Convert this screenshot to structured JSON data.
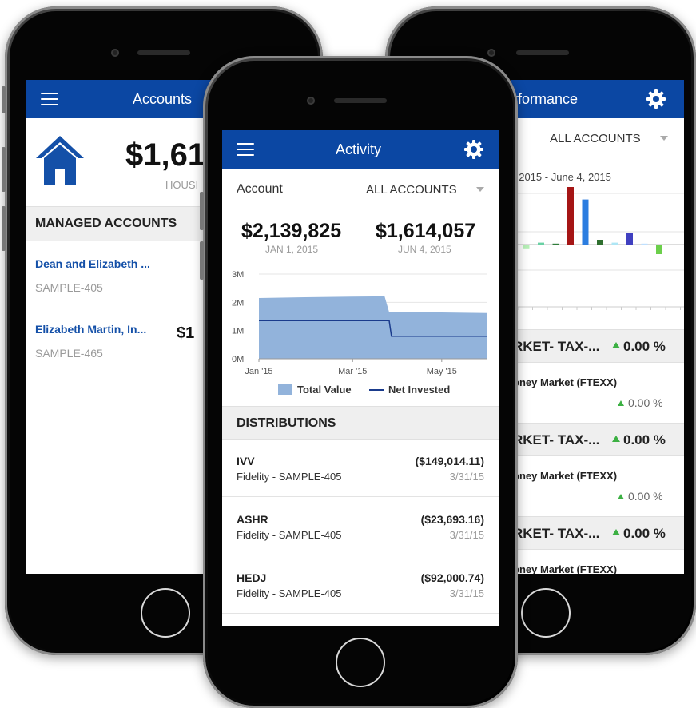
{
  "left": {
    "title": "Accounts",
    "total": "$1,61",
    "subtitle": "HOUSI",
    "section": "MANAGED ACCOUNTS",
    "items": [
      {
        "name": "Dean and Elizabeth ...",
        "id": "SAMPLE-405",
        "value": ""
      },
      {
        "name": "Elizabeth Martin, In...",
        "id": "SAMPLE-465",
        "value": "$1"
      }
    ]
  },
  "center": {
    "title": "Activity",
    "account_label": "Account",
    "account_value": "ALL ACCOUNTS",
    "start_value": "$2,139,825",
    "start_date": "JAN 1, 2015",
    "end_value": "$1,614,057",
    "end_date": "JUN 4, 2015",
    "legend": {
      "total": "Total Value",
      "net": "Net Invested"
    },
    "section": "DISTRIBUTIONS",
    "distributions": [
      {
        "symbol": "IVV",
        "account": "Fidelity - SAMPLE-405",
        "amount": "($149,014.11)",
        "date": "3/31/15"
      },
      {
        "symbol": "ASHR",
        "account": "Fidelity - SAMPLE-405",
        "amount": "($23,693.16)",
        "date": "3/31/15"
      },
      {
        "symbol": "HEDJ",
        "account": "Fidelity - SAMPLE-405",
        "amount": "($92,000.74)",
        "date": "3/31/15"
      }
    ]
  },
  "right": {
    "title": "rformance",
    "account_value": "ALL ACCOUNTS",
    "date_range": ", 2015 - June 4, 2015",
    "groups": [
      {
        "header": "RKET- TAX-...",
        "pct": "0.00 %",
        "fund": "oney Market (FTEXX)",
        "fund_pct": "0.00 %"
      },
      {
        "header": "RKET- TAX-...",
        "pct": "0.00 %",
        "fund": "oney Market (FTEXX)",
        "fund_pct": "0.00 %"
      },
      {
        "header": "RKET- TAX-...",
        "pct": "0.00 %",
        "fund": "oney Market (FTEXX)",
        "fund_pct": ""
      }
    ],
    "bars": [
      {
        "color": "#2b7de0",
        "value": 0.1
      },
      {
        "color": "#b7f0b7",
        "value": -0.04
      },
      {
        "color": "#69d1a4",
        "value": 0.02
      },
      {
        "color": "#2f7d3a",
        "value": 0.01
      },
      {
        "color": "#a51515",
        "value": 0.6
      },
      {
        "color": "#2b7de0",
        "value": 0.47
      },
      {
        "color": "#2f6f2f",
        "value": 0.05
      },
      {
        "color": "#aee6f5",
        "value": 0.02
      },
      {
        "color": "#4040c0",
        "value": 0.12
      },
      {
        "color": "#bfe0ff",
        "value": 0.01
      },
      {
        "color": "#6ccf4b",
        "value": -0.1
      }
    ]
  },
  "chart_data": {
    "type": "area",
    "x_ticks": [
      "Jan '15",
      "Mar '15",
      "May '15"
    ],
    "y_ticks": [
      "3M",
      "2M",
      "1M",
      "0M"
    ],
    "ylim": [
      0,
      3000000
    ],
    "series": [
      {
        "name": "Total Value",
        "type": "area",
        "color": "#92b3db",
        "points": [
          [
            0,
            2150000
          ],
          [
            0.2,
            2180000
          ],
          [
            0.4,
            2200000
          ],
          [
            0.55,
            2210000
          ],
          [
            0.57,
            1650000
          ],
          [
            0.8,
            1640000
          ],
          [
            1,
            1620000
          ]
        ]
      },
      {
        "name": "Net Invested",
        "type": "line",
        "color": "#1a3b8c",
        "points": [
          [
            0,
            1350000
          ],
          [
            0.57,
            1350000
          ],
          [
            0.58,
            800000
          ],
          [
            1,
            800000
          ]
        ]
      }
    ]
  }
}
